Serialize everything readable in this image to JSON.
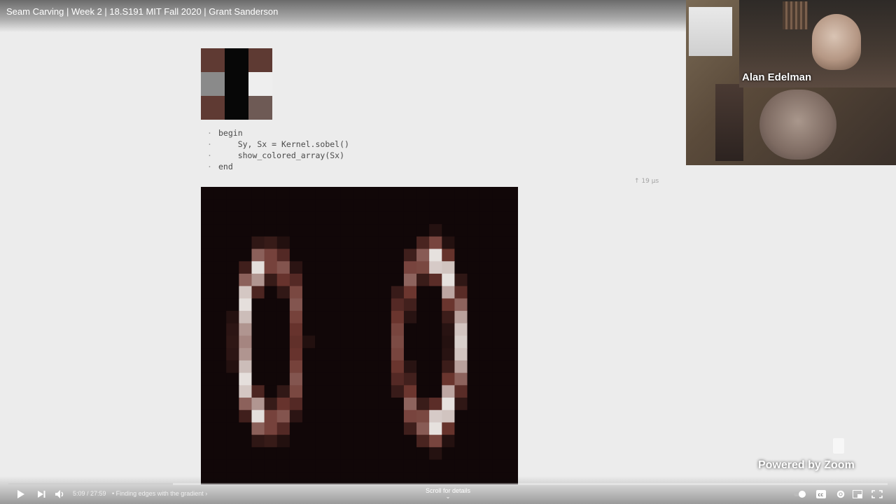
{
  "video": {
    "title": "Seam Carving | Week 2 | 18.S191 MIT Fall 2020 | Grant Sanderson"
  },
  "kernel_preview": {
    "cells": [
      "#5f3a33",
      "#070707",
      "#5e3a33",
      "#8a8a8a",
      "#070707",
      "#eeeeee",
      "#5f3a33",
      "#070707",
      "#6e5a55"
    ]
  },
  "code_cell": {
    "lines": [
      {
        "gutter": "·",
        "text": "begin"
      },
      {
        "gutter": "·",
        "text": "    Sy, Sx = Kernel.sobel()"
      },
      {
        "gutter": "·",
        "text": "    show_colored_array(Sx)"
      },
      {
        "gutter": "·",
        "text": "end"
      }
    ],
    "runtime": "↑  19 μs"
  },
  "webcam": {
    "speaker_name": "Alan Edelman"
  },
  "branding": {
    "zoom_text": "Powered by Zoom"
  },
  "player": {
    "time_display": "5:09 / 27:59",
    "chapter_label": "• Finding edges with the gradient ›",
    "scroll_hint": "Scroll for details",
    "progress": 0.187,
    "icons": [
      "play-icon",
      "next-icon",
      "volume-icon",
      "autoplay-toggle-icon",
      "captions-icon",
      "settings-icon",
      "miniplayer-icon",
      "theater-icon",
      "fullscreen-icon"
    ]
  }
}
